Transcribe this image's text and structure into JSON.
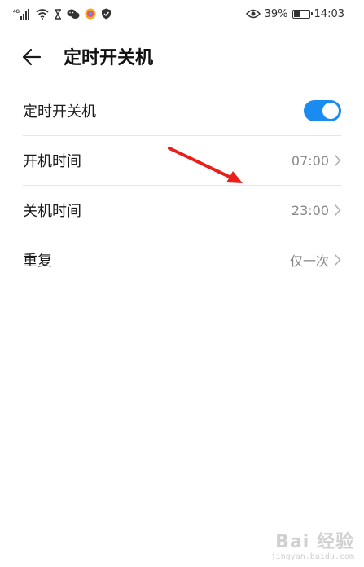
{
  "status_bar": {
    "network_label": "4G",
    "battery_percent": "39%",
    "battery_level": 0.39,
    "time": "14:03",
    "icons_left": [
      "signal-icon",
      "wifi-icon",
      "hourglass-icon",
      "wechat-icon",
      "app-icon",
      "shield-icon"
    ],
    "icons_right": [
      "eye-icon",
      "battery-icon"
    ]
  },
  "header": {
    "title": "定时开关机",
    "back_icon": "back-arrow-icon"
  },
  "settings": {
    "items": [
      {
        "label": "定时开关机",
        "type": "toggle",
        "enabled": true
      },
      {
        "label": "开机时间",
        "value": "07:00",
        "type": "link"
      },
      {
        "label": "关机时间",
        "value": "23:00",
        "type": "link"
      },
      {
        "label": "重复",
        "value": "仅一次",
        "type": "link"
      }
    ]
  },
  "colors": {
    "toggle_on": "#1a8cf0",
    "annotation": "#e8201b",
    "value_text": "#888888"
  },
  "watermark": {
    "main": "Bai 经验",
    "sub": "jingyan.baidu.com"
  }
}
